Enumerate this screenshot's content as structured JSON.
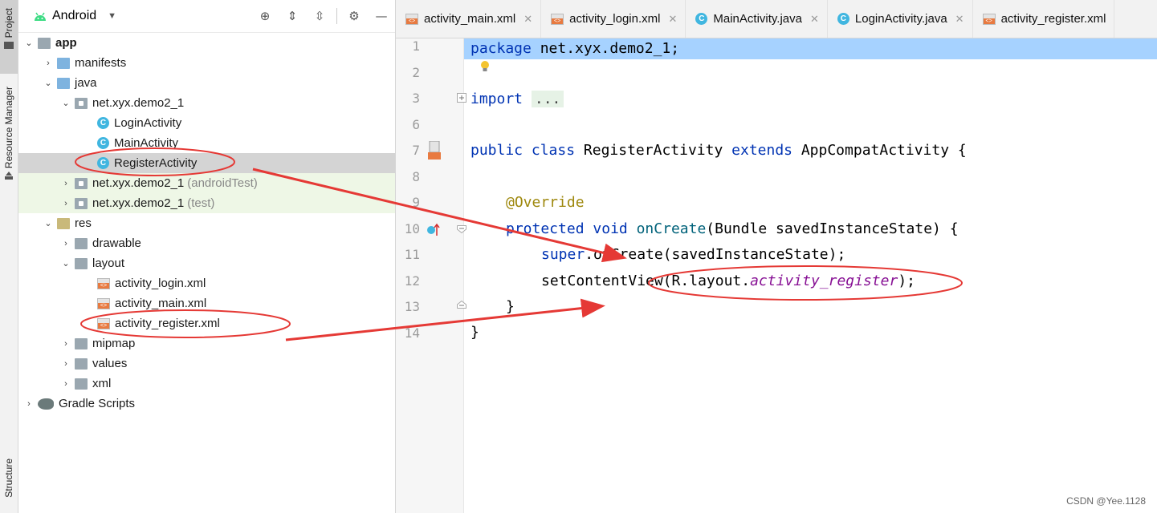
{
  "toolstrip": {
    "project_label": "Project",
    "resource_manager_label": "Resource Manager",
    "structure_label": "Structure"
  },
  "project_panel": {
    "view_label": "Android",
    "icons": [
      "locate-icon",
      "expand-all-icon",
      "collapse-all-icon",
      "gear-icon",
      "hide-icon"
    ]
  },
  "tree": {
    "app": "app",
    "manifests": "manifests",
    "java": "java",
    "pkg_main": "net.xyx.demo2_1",
    "login_activity": "LoginActivity",
    "main_activity": "MainActivity",
    "register_activity": "RegisterActivity",
    "pkg_android_test": "net.xyx.demo2_1",
    "android_test_suffix": "(androidTest)",
    "pkg_test": "net.xyx.demo2_1",
    "test_suffix": "(test)",
    "res": "res",
    "drawable": "drawable",
    "layout": "layout",
    "activity_login": "activity_login.xml",
    "activity_main": "activity_main.xml",
    "activity_register": "activity_register.xml",
    "mipmap": "mipmap",
    "values": "values",
    "xml": "xml",
    "gradle_scripts": "Gradle Scripts"
  },
  "tabs": [
    {
      "label": "activity_main.xml",
      "type": "xml"
    },
    {
      "label": "activity_login.xml",
      "type": "xml"
    },
    {
      "label": "MainActivity.java",
      "type": "class"
    },
    {
      "label": "LoginActivity.java",
      "type": "class"
    },
    {
      "label": "activity_register.xml",
      "type": "xml"
    }
  ],
  "editor": {
    "line_numbers": [
      "1",
      "2",
      "3",
      "6",
      "7",
      "8",
      "9",
      "10",
      "11",
      "12",
      "13",
      "14"
    ],
    "code": {
      "l1_kw": "package",
      "l1_rest": " net.xyx.demo2_1;",
      "l3_kw": "import",
      "l3_fold": "...",
      "l7_kw1": "public",
      "l7_kw2": "class",
      "l7_name": "RegisterActivity",
      "l7_kw3": "extends",
      "l7_rest": " AppCompatActivity {",
      "l9_ann": "@Override",
      "l10_kw1": "protected",
      "l10_kw2": "void",
      "l10_fn": "onCreate",
      "l10_rest": "(Bundle savedInstanceState) {",
      "l11_kw": "super",
      "l11_rest": ".onCreate(savedInstanceState);",
      "l12_pre": "setContentView(R.layout.",
      "l12_it": "activity_register",
      "l12_post": ");",
      "l13": "}",
      "l14": "}"
    }
  },
  "watermark": "CSDN @Yee.1128",
  "colors": {
    "keyword": "#0033b3",
    "function": "#00627a",
    "annotation": "#9e880d",
    "italic_field": "#871094",
    "annotation_red": "#e53935",
    "selection": "#a6d2ff"
  }
}
